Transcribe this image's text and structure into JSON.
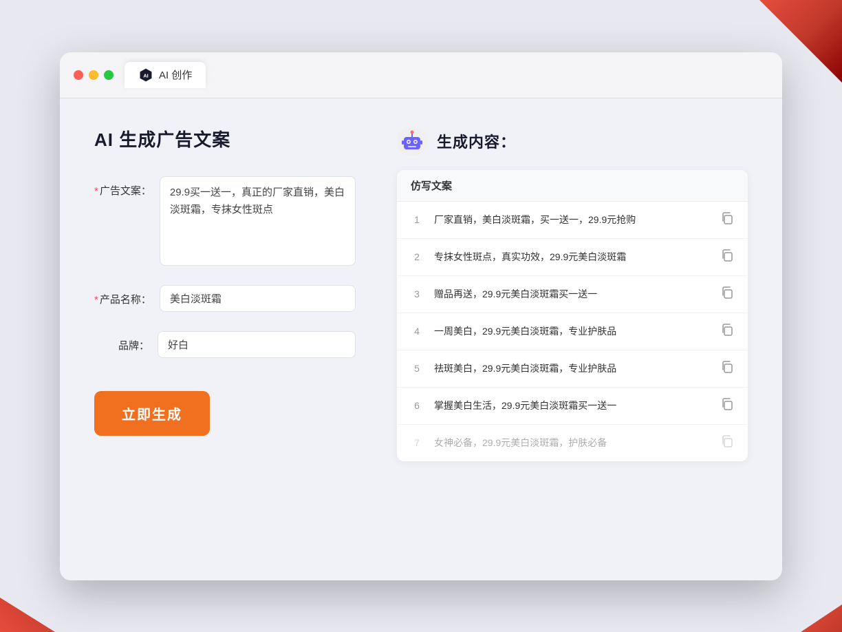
{
  "browser": {
    "tab_label": "AI 创作"
  },
  "page": {
    "title": "AI 生成广告文案",
    "right_title": "生成内容："
  },
  "form": {
    "ad_label": "广告文案：",
    "ad_required": true,
    "ad_value": "29.9买一送一，真正的厂家直销，美白淡斑霜，专抹女性斑点",
    "product_label": "产品名称：",
    "product_required": true,
    "product_value": "美白淡斑霜",
    "brand_label": "品牌：",
    "brand_required": false,
    "brand_value": "好白",
    "generate_btn": "立即生成"
  },
  "results": {
    "column_header": "仿写文案",
    "items": [
      {
        "id": 1,
        "text": "厂家直销，美白淡斑霜，买一送一，29.9元抢购",
        "dimmed": false
      },
      {
        "id": 2,
        "text": "专抹女性斑点，真实功效，29.9元美白淡斑霜",
        "dimmed": false
      },
      {
        "id": 3,
        "text": "赠品再送，29.9元美白淡斑霜买一送一",
        "dimmed": false
      },
      {
        "id": 4,
        "text": "一周美白，29.9元美白淡斑霜，专业护肤品",
        "dimmed": false
      },
      {
        "id": 5,
        "text": "祛斑美白，29.9元美白淡斑霜，专业护肤品",
        "dimmed": false
      },
      {
        "id": 6,
        "text": "掌握美白生活，29.9元美白淡斑霜买一送一",
        "dimmed": false
      },
      {
        "id": 7,
        "text": "女神必备，29.9元美白淡斑霜，护肤必备",
        "dimmed": true
      }
    ]
  }
}
